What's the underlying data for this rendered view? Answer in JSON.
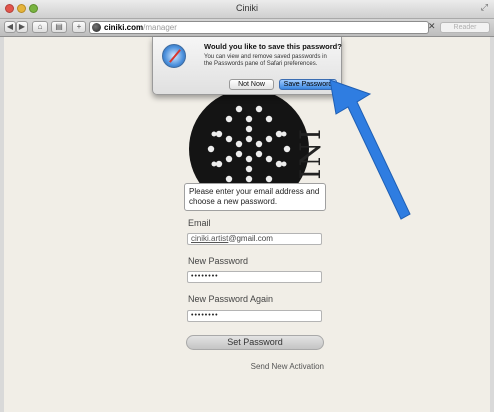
{
  "window": {
    "title": "Ciniki"
  },
  "toolbar": {
    "back": "◀",
    "forward": "▶",
    "home": "⌂",
    "bookmarks": "▤",
    "add": "+",
    "url_domain": "ciniki.com",
    "url_path": "/manager",
    "clear": "✕",
    "reader": "Reader"
  },
  "dialog": {
    "title": "Would you like to save this password?",
    "body": "You can view and remove saved passwords in the Passwords pane of Safari preferences.",
    "not_now": "Not Now",
    "save": "Save Password"
  },
  "page": {
    "logo_word": "CINI",
    "instructions": "Please enter your email address and choose a new password.",
    "email_label": "Email",
    "email_value_user": "ciniki.artist",
    "email_value_domain": "@gmail.com",
    "new_password_label": "New Password",
    "new_password_value": "••••••••",
    "new_password_again_label": "New Password Again",
    "new_password_again_value": "••••••••",
    "set_password": "Set Password",
    "send_activation": "Send New Activation"
  },
  "colors": {
    "page_bg": "#f1eee7",
    "arrow": "#2f7de1",
    "accent_button": "#3a86e0"
  }
}
